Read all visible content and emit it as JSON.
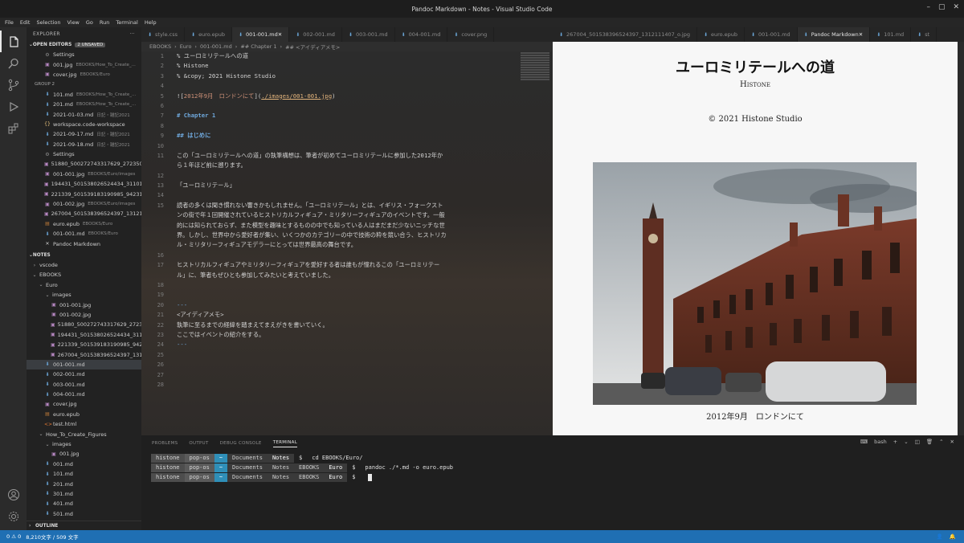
{
  "window": {
    "title": "Pandoc Markdown - Notes - Visual Studio Code"
  },
  "menu": [
    "File",
    "Edit",
    "Selection",
    "View",
    "Go",
    "Run",
    "Terminal",
    "Help"
  ],
  "sidebar": {
    "header": "EXPLORER",
    "open_editors": "OPEN EDITORS",
    "unsaved_badge": "2 UNSAVED",
    "group1": [
      {
        "icon": "gear",
        "name": "Settings",
        "hint": ""
      },
      {
        "icon": "img",
        "name": "001.jpg",
        "hint": "EBOOKS/How_To_Create_..."
      },
      {
        "icon": "img",
        "name": "cover.jpg",
        "hint": "EBOOKS/Euro"
      }
    ],
    "group2_label": "GROUP 2",
    "group2": [
      {
        "icon": "md",
        "name": "101.md",
        "hint": "EBOOKS/How_To_Create_..."
      },
      {
        "icon": "md",
        "name": "201.md",
        "hint": "EBOOKS/How_To_Create_..."
      },
      {
        "icon": "md",
        "name": "2021-01-03.md",
        "hint": "日記・雑記2021"
      },
      {
        "icon": "json",
        "name": "workspace.code-workspace",
        "hint": ""
      },
      {
        "icon": "md",
        "name": "2021-09-17.md",
        "hint": "日記・雑記2021"
      },
      {
        "icon": "md",
        "name": "2021-09-18.md",
        "hint": "日記・雑記2021"
      },
      {
        "icon": "gear",
        "name": "Settings",
        "hint": ""
      },
      {
        "icon": "img",
        "name": "51880_500272743317629_2723504...",
        "hint": ""
      },
      {
        "icon": "img",
        "name": "001-001.jpg",
        "hint": "EBOOKS/Euro/images"
      },
      {
        "icon": "img",
        "name": "194431_501538026524434_31101...",
        "hint": ""
      },
      {
        "icon": "img",
        "name": "221339_501539183190985_94231...",
        "hint": ""
      },
      {
        "icon": "img",
        "name": "001-002.jpg",
        "hint": "EBOOKS/Euro/images"
      },
      {
        "icon": "img",
        "name": "267004_501538396524397_131211...",
        "hint": ""
      },
      {
        "icon": "epub",
        "name": "euro.epub",
        "hint": "EBOOKS/Euro"
      },
      {
        "icon": "md",
        "name": "001-001.md",
        "hint": "EBOOKS/Euro"
      },
      {
        "icon": "close",
        "name": "Pandoc Markdown",
        "hint": ""
      }
    ],
    "notes_label": "NOTES",
    "tree": [
      {
        "depth": 0,
        "chev": "›",
        "icon": "",
        "name": "vscode"
      },
      {
        "depth": 0,
        "chev": "⌄",
        "icon": "",
        "name": "EBOOKS"
      },
      {
        "depth": 1,
        "chev": "⌄",
        "icon": "",
        "name": "Euro"
      },
      {
        "depth": 2,
        "chev": "⌄",
        "icon": "",
        "name": "images"
      },
      {
        "depth": 3,
        "chev": "",
        "icon": "img",
        "name": "001-001.jpg"
      },
      {
        "depth": 3,
        "chev": "",
        "icon": "img",
        "name": "001-002.jpg"
      },
      {
        "depth": 3,
        "chev": "",
        "icon": "img",
        "name": "51880_500272743317629_27235048..."
      },
      {
        "depth": 3,
        "chev": "",
        "icon": "img",
        "name": "194431_501538026524434_311010..."
      },
      {
        "depth": 3,
        "chev": "",
        "icon": "img",
        "name": "221339_501539183190985_942316..."
      },
      {
        "depth": 3,
        "chev": "",
        "icon": "img",
        "name": "267004_501538396524397_1312111..."
      },
      {
        "depth": 2,
        "chev": "",
        "icon": "md",
        "name": "001-001.md",
        "sel": true
      },
      {
        "depth": 2,
        "chev": "",
        "icon": "md",
        "name": "002-001.md"
      },
      {
        "depth": 2,
        "chev": "",
        "icon": "md",
        "name": "003-001.md"
      },
      {
        "depth": 2,
        "chev": "",
        "icon": "md",
        "name": "004-001.md"
      },
      {
        "depth": 2,
        "chev": "",
        "icon": "img",
        "name": "cover.jpg"
      },
      {
        "depth": 2,
        "chev": "",
        "icon": "epub",
        "name": "euro.epub"
      },
      {
        "depth": 2,
        "chev": "",
        "icon": "html",
        "name": "test.html"
      },
      {
        "depth": 1,
        "chev": "⌄",
        "icon": "",
        "name": "How_To_Create_Figures"
      },
      {
        "depth": 2,
        "chev": "⌄",
        "icon": "",
        "name": "images"
      },
      {
        "depth": 3,
        "chev": "",
        "icon": "img",
        "name": "001.jpg"
      },
      {
        "depth": 2,
        "chev": "",
        "icon": "md",
        "name": "001.md"
      },
      {
        "depth": 2,
        "chev": "",
        "icon": "md",
        "name": "101.md"
      },
      {
        "depth": 2,
        "chev": "",
        "icon": "md",
        "name": "201.md"
      },
      {
        "depth": 2,
        "chev": "",
        "icon": "md",
        "name": "301.md"
      },
      {
        "depth": 2,
        "chev": "",
        "icon": "md",
        "name": "401.md"
      },
      {
        "depth": 2,
        "chev": "",
        "icon": "md",
        "name": "501.md"
      }
    ],
    "outline_label": "OUTLINE"
  },
  "tabs_left": [
    {
      "name": "style.css",
      "active": false
    },
    {
      "name": "euro.epub",
      "active": false
    },
    {
      "name": "001-001.md",
      "active": true
    },
    {
      "name": "002-001.md",
      "active": false
    },
    {
      "name": "003-001.md",
      "active": false
    },
    {
      "name": "004-001.md",
      "active": false
    },
    {
      "name": "cover.png",
      "active": false
    }
  ],
  "tabs_right": [
    {
      "name": "267004_501538396524397_1312111407_o.jpg",
      "active": false
    },
    {
      "name": "euro.epub",
      "active": false
    },
    {
      "name": "001-001.md",
      "active": false
    },
    {
      "name": "Pandoc Markdown",
      "active": true
    },
    {
      "name": "101.md",
      "active": false
    },
    {
      "name": "st",
      "active": false
    }
  ],
  "breadcrumb": [
    "EBOOKS",
    "Euro",
    "001-001.md",
    "## Chapter 1",
    "## <アイディアメモ>"
  ],
  "editor": {
    "lines": [
      {
        "n": "1",
        "t": "% ユーロミリテールへの道",
        "k": "plain"
      },
      {
        "n": "2",
        "t": "% Histone",
        "k": "plain"
      },
      {
        "n": "3",
        "t": "% &copy; 2021 Histone Studio",
        "k": "plain"
      },
      {
        "n": "4",
        "t": "",
        "k": "plain"
      },
      {
        "n": "5",
        "t": "",
        "k": "img"
      },
      {
        "n": "6",
        "t": "",
        "k": "plain"
      },
      {
        "n": "7",
        "t": "# Chapter 1",
        "k": "h"
      },
      {
        "n": "8",
        "t": "",
        "k": "plain"
      },
      {
        "n": "9",
        "t": "## はじめに",
        "k": "h"
      },
      {
        "n": "10",
        "t": "",
        "k": "plain"
      },
      {
        "n": "11",
        "t": "この「ユーロミリテールへの道」の執筆構想は、筆者が初めてユーロミリテールに参加した2012年か",
        "k": "plain"
      },
      {
        "n": "",
        "t": "ら１年ほど前に遡ります。",
        "k": "plain"
      },
      {
        "n": "12",
        "t": "",
        "k": "plain"
      },
      {
        "n": "13",
        "t": "「ユーロミリテール」",
        "k": "plain"
      },
      {
        "n": "14",
        "t": "",
        "k": "plain"
      },
      {
        "n": "15",
        "t": "読者の多くは聞き慣れない響きかもしれません。「ユーロミリテール」とは、イギリス・フォークスト",
        "k": "plain"
      },
      {
        "n": "",
        "t": "ンの街で年１回開催されているヒストリカルフィギュア・ミリタリーフィギュアのイベントです。一般",
        "k": "plain"
      },
      {
        "n": "",
        "t": "的には知られておらず、また模型を趣味とするものの中でも知っている人はまだまだ少ないニッチな世",
        "k": "plain"
      },
      {
        "n": "",
        "t": "界。しかし、世界中から愛好者が集い、いくつかのカテゴリーの中で技術の粋を競い合う、ヒストリカ",
        "k": "plain"
      },
      {
        "n": "",
        "t": "ル・ミリタリーフィギュアモデラーにとっては世界最高の舞台です。",
        "k": "plain"
      },
      {
        "n": "16",
        "t": "",
        "k": "plain"
      },
      {
        "n": "17",
        "t": "ヒストリカルフィギュアやミリタリーフィギュアを愛好する者は誰もが憧れるこの「ユーロミリテー",
        "k": "plain"
      },
      {
        "n": "",
        "t": "ル」に、筆者もぜひとも参加してみたいと考えていました。",
        "k": "plain"
      },
      {
        "n": "18",
        "t": "",
        "k": "plain"
      },
      {
        "n": "19",
        "t": "",
        "k": "plain"
      },
      {
        "n": "20",
        "t": "---",
        "k": "hr"
      },
      {
        "n": "21",
        "t": "<アイディアメモ>",
        "k": "plain"
      },
      {
        "n": "22",
        "t": "執筆に至るまでの経緯を踏まえてまえがきを書いていく。",
        "k": "plain"
      },
      {
        "n": "23",
        "t": "ここではイベントの紹介をする。",
        "k": "plain"
      },
      {
        "n": "24",
        "t": "---",
        "k": "hr"
      },
      {
        "n": "25",
        "t": "",
        "k": "plain"
      },
      {
        "n": "26",
        "t": "",
        "k": "plain"
      },
      {
        "n": "27",
        "t": "",
        "k": "plain"
      },
      {
        "n": "28",
        "t": "",
        "k": "plain"
      }
    ],
    "img_alt": "2012年9月　ロンドンにて",
    "img_url": "./images/001-001.jpg"
  },
  "preview": {
    "title": "ユーロミリテールへの道",
    "author": "Histone",
    "date": "© 2021 Histone Studio",
    "caption": "2012年9月　ロンドンにて"
  },
  "panel": {
    "tabs": [
      "PROBLEMS",
      "OUTPUT",
      "DEBUG CONSOLE",
      "TERMINAL"
    ],
    "active_tab": "TERMINAL",
    "shell": "bash",
    "terminal": [
      {
        "path": [
          "Documents",
          "Notes"
        ],
        "cmd": "cd EBOOKS/Euro/"
      },
      {
        "path": [
          "Documents",
          "Notes",
          "EBOOKS",
          "Euro"
        ],
        "cmd": "pandoc ./*.md -o euro.epub"
      },
      {
        "path": [
          "Documents",
          "Notes",
          "EBOOKS",
          "Euro"
        ],
        "cmd": ""
      }
    ],
    "user": "histone",
    "host": "pop-os",
    "home": "~",
    "prompt": "$"
  },
  "status": {
    "counts": "0 ⚠ 0",
    "words": "8,210文字 / 509 文字"
  }
}
